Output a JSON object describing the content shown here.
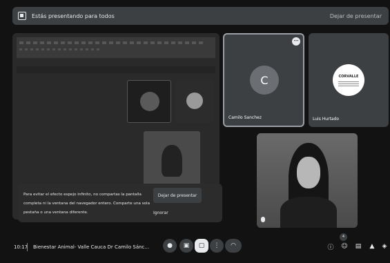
{
  "top_banner": {
    "title": "Estás presentando para todos",
    "stop_label": "Dejar de presentar"
  },
  "participants": {
    "camilo": {
      "initial": "C",
      "name": "Camilo Sanchez"
    },
    "luis": {
      "name": "Luis Hurtado",
      "logo_text": "CORVALLE"
    }
  },
  "notice": {
    "message": "Para evitar el efecto espejo infinito, no compartas la pantalla completa ni la ventana del navegador entero. Comparte una sola pestaña o una ventana diferente.",
    "stop_label": "Dejar de presentar",
    "ignore_label": "Ignorar"
  },
  "bottom": {
    "time": "10:17",
    "meeting_title": "Bienestar Animal- Valle Cauca Dr Camilo Sánc...",
    "participant_count": "4"
  },
  "icons": [
    "present-icon",
    "more-icon",
    "mic-icon",
    "captions-icon",
    "present-screen-icon",
    "more-options-icon",
    "end-call-icon",
    "info-icon",
    "people-icon",
    "chat-icon",
    "activities-icon",
    "lock-icon"
  ],
  "colors": {
    "bar": "#3c4043",
    "background": "#121212",
    "text": "#e8eaed"
  }
}
